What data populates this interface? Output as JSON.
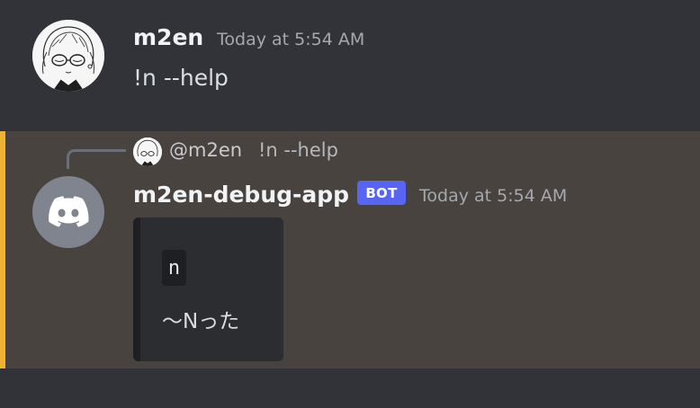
{
  "messages": [
    {
      "author": "m2en",
      "timestamp": "Today at 5:54 AM",
      "avatar_icon": "anime-girl-glasses-avatar",
      "content": "!n --help"
    },
    {
      "author": "m2en-debug-app",
      "tag": "BOT",
      "timestamp": "Today at 5:54 AM",
      "avatar_icon": "discord-logo-icon",
      "reply": {
        "mention": "@m2en",
        "text": "!n --help"
      },
      "embed": {
        "code": "n",
        "text": "〜Nった"
      }
    }
  ],
  "colors": {
    "background": "#313338",
    "highlight_background": "#48433f",
    "mention_bar": "#f0b232",
    "bot_tag": "#5865f2",
    "embed_background": "#2b2d31"
  }
}
